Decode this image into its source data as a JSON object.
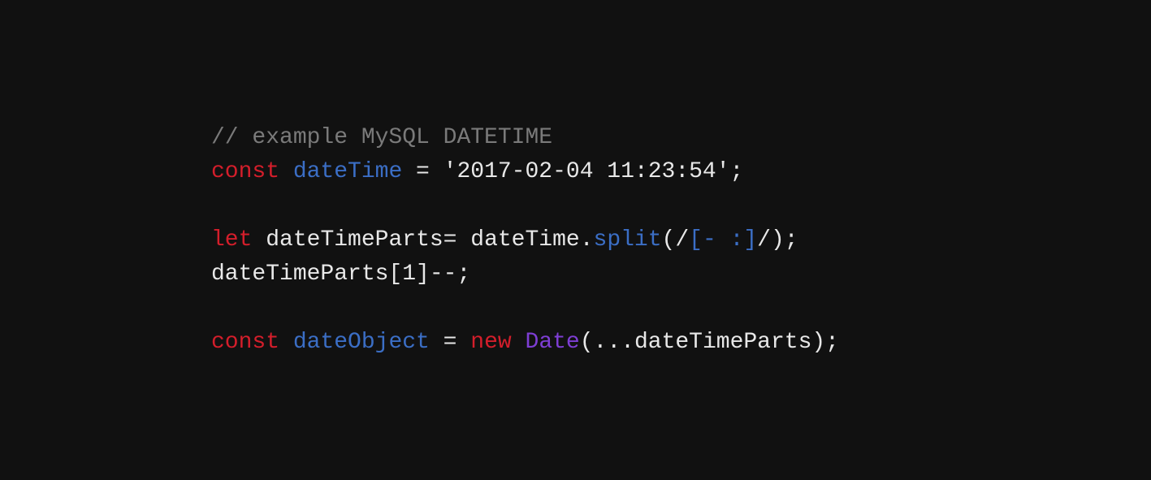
{
  "code": {
    "line1": {
      "comment": "// example MySQL DATETIME"
    },
    "line2": {
      "keyword": "const",
      "variable": "dateTime",
      "equals": " = ",
      "string": "'2017-02-04 11:23:54'",
      "semi": ";"
    },
    "line3": {
      "keyword": "let",
      "variable": "dateTimeParts",
      "equals": "= dateTime.",
      "method": "split",
      "openParen": "(",
      "regexSlash1": "/",
      "regexBracket": "[- :]",
      "regexSlash2": "/",
      "closeParen": ")",
      "semi": ";"
    },
    "line4": {
      "text": "dateTimeParts[1]--;"
    },
    "line5": {
      "keyword": "const",
      "variable": "dateObject",
      "equals": " = ",
      "newKeyword": "new",
      "space": " ",
      "className": "Date",
      "rest": "(...dateTimeParts);"
    }
  }
}
